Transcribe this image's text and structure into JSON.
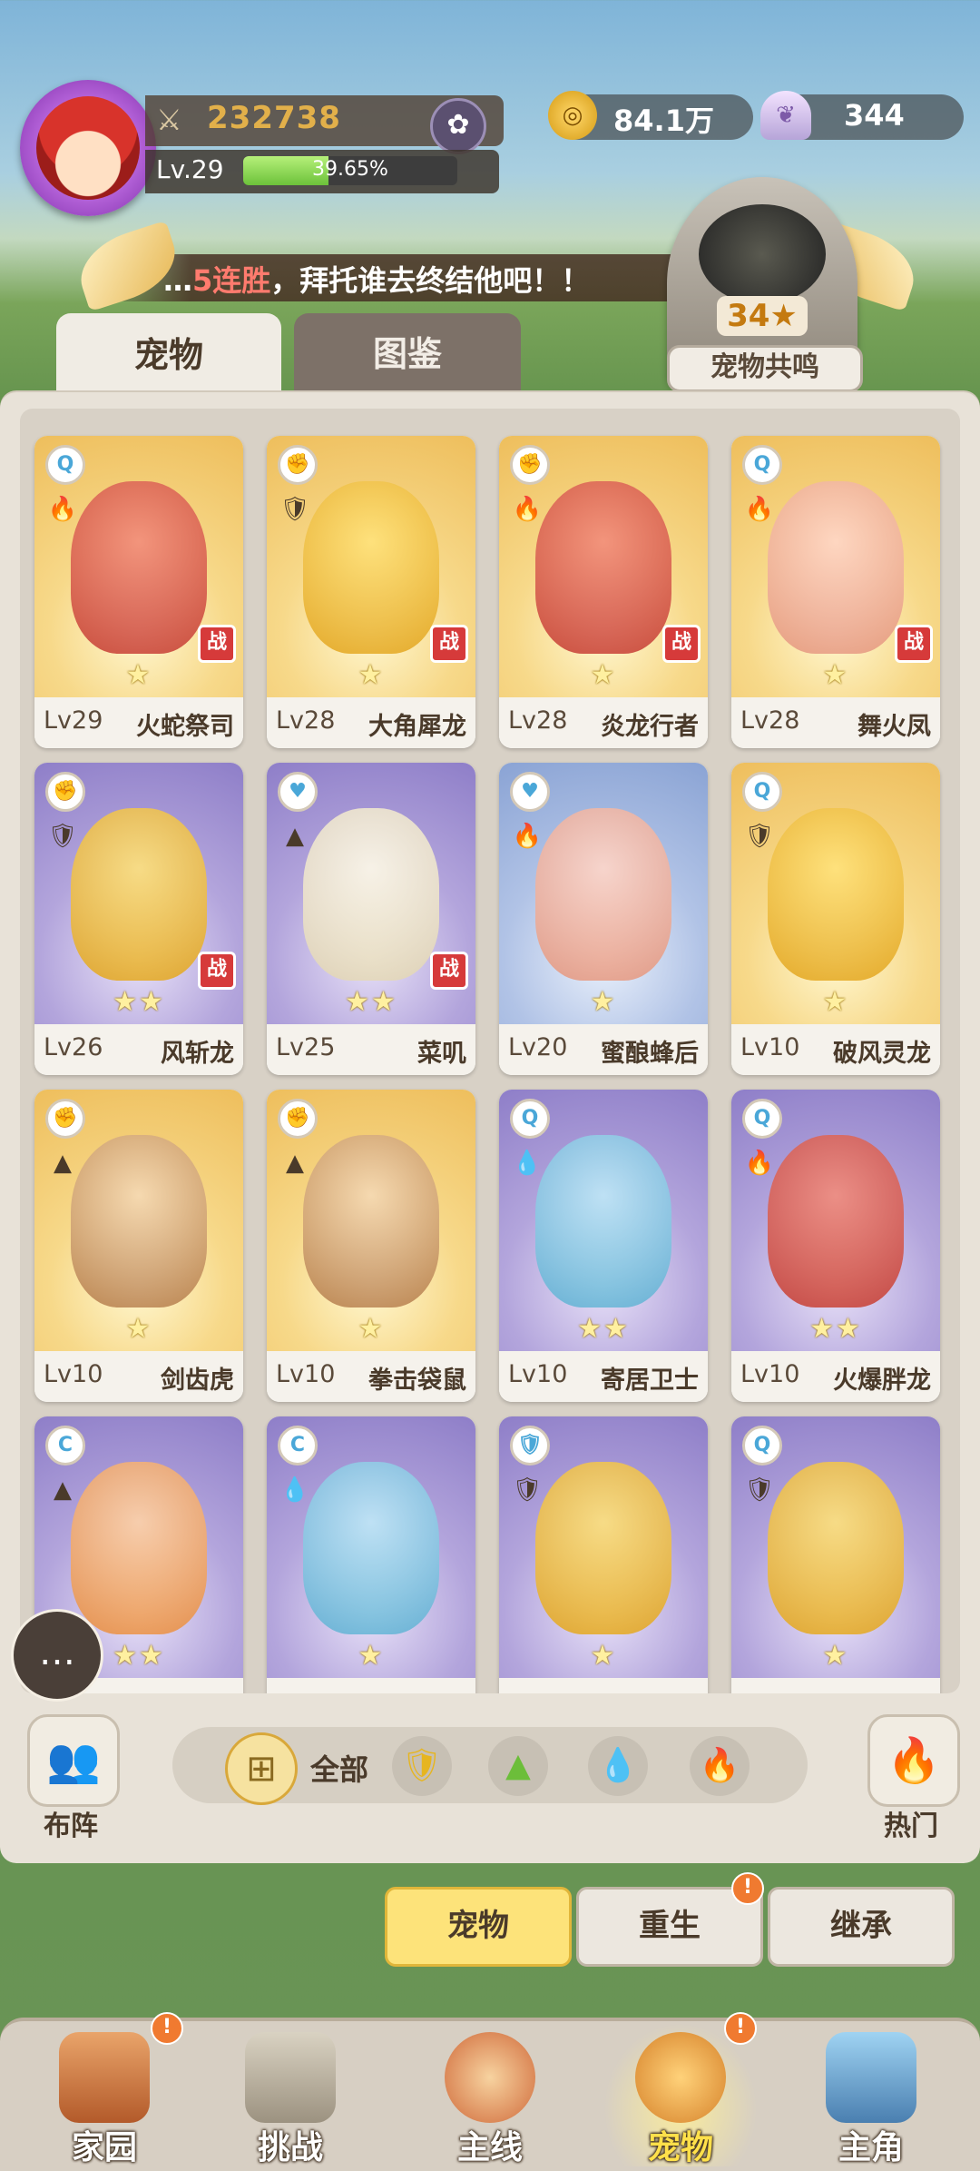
{
  "player": {
    "power": "232738",
    "level": "Lv.29",
    "exp_percent": "39.65%",
    "exp_fraction": 0.3965
  },
  "currency": {
    "coins": "84.1万",
    "shells": "344"
  },
  "marquee": {
    "highlight": "5连胜",
    "text": "，拜托谁去终结他吧！！",
    "prefix": "…"
  },
  "resonance": {
    "count": "34★",
    "label": "宠物共鸣"
  },
  "tabs": {
    "pets": "宠物",
    "book": "图鉴"
  },
  "battle_badge": "战",
  "pets": [
    {
      "level": "Lv29",
      "name": "火蛇祭司",
      "stars": "★",
      "bg": "gold",
      "tint": "c-red",
      "type": "Q",
      "elem1": "🔥",
      "elem2": "",
      "battle": true
    },
    {
      "level": "Lv28",
      "name": "大角犀龙",
      "stars": "★",
      "bg": "gold",
      "tint": "c-yellow",
      "type": "✊",
      "elem1": "🛡",
      "elem2": "",
      "battle": true
    },
    {
      "level": "Lv28",
      "name": "炎龙行者",
      "stars": "★",
      "bg": "gold",
      "tint": "c-red",
      "type": "✊",
      "elem1": "🔥",
      "elem2": "",
      "battle": true
    },
    {
      "level": "Lv28",
      "name": "舞火凤",
      "stars": "★",
      "bg": "gold",
      "tint": "c-pink",
      "type": "Q",
      "elem1": "🔥",
      "elem2": "",
      "battle": true
    },
    {
      "level": "Lv26",
      "name": "风斩龙",
      "stars": "★★",
      "bg": "purple",
      "tint": "c-yellow",
      "type": "✊",
      "elem1": "🛡",
      "elem2": "",
      "battle": true
    },
    {
      "level": "Lv25",
      "name": "菜叽",
      "stars": "★★",
      "bg": "purple",
      "tint": "c-cream",
      "type": "♥",
      "elem1": "▲",
      "elem2": "",
      "battle": true
    },
    {
      "level": "Lv20",
      "name": "蜜酿蜂后",
      "stars": "★",
      "bg": "blue",
      "tint": "c-pink",
      "type": "♥",
      "elem1": "🔥",
      "elem2": "",
      "battle": false
    },
    {
      "level": "Lv10",
      "name": "破风灵龙",
      "stars": "★",
      "bg": "gold",
      "tint": "c-yellow",
      "type": "Q",
      "elem1": "🛡",
      "elem2": "",
      "battle": false
    },
    {
      "level": "Lv10",
      "name": "剑齿虎",
      "stars": "★",
      "bg": "gold",
      "tint": "c-brown",
      "type": "✊",
      "elem1": "▲",
      "elem2": "",
      "battle": false
    },
    {
      "level": "Lv10",
      "name": "拳击袋鼠",
      "stars": "★",
      "bg": "gold",
      "tint": "c-brown",
      "type": "✊",
      "elem1": "▲",
      "elem2": "",
      "battle": false
    },
    {
      "level": "Lv10",
      "name": "寄居卫士",
      "stars": "★★",
      "bg": "purple",
      "tint": "c-blue",
      "type": "Q",
      "elem1": "💧",
      "elem2": "",
      "battle": false
    },
    {
      "level": "Lv10",
      "name": "火爆胖龙",
      "stars": "★★",
      "bg": "purple",
      "tint": "c-red",
      "type": "Q",
      "elem1": "🔥",
      "elem2": "",
      "battle": false
    },
    {
      "level": "",
      "name": "",
      "stars": "★★",
      "bg": "purple",
      "tint": "c-orange",
      "type": "C",
      "elem1": "▲",
      "elem2": "",
      "battle": false
    },
    {
      "level": "",
      "name": "",
      "stars": "★",
      "bg": "purple",
      "tint": "c-blue",
      "type": "C",
      "elem1": "💧",
      "elem2": "",
      "battle": false
    },
    {
      "level": "",
      "name": "",
      "stars": "★",
      "bg": "purple",
      "tint": "c-yellow",
      "type": "🛡",
      "elem1": "🛡",
      "elem2": "",
      "battle": false
    },
    {
      "level": "",
      "name": "",
      "stars": "★",
      "bg": "purple",
      "tint": "c-yellow",
      "type": "Q",
      "elem1": "🛡",
      "elem2": "",
      "battle": false
    }
  ],
  "filter": {
    "formation_label": "布阵",
    "all_label": "全部",
    "hot_label": "热门"
  },
  "sub_buttons": {
    "pets": "宠物",
    "rebirth": "重生",
    "inherit": "继承"
  },
  "alert": "!",
  "nav": {
    "home": "家园",
    "challenge": "挑战",
    "main": "主线",
    "pets": "宠物",
    "hero": "主角"
  }
}
